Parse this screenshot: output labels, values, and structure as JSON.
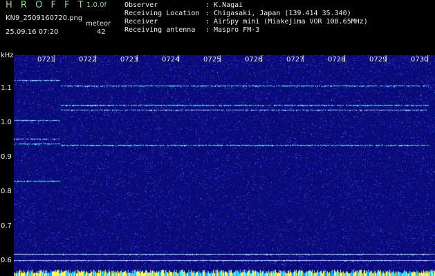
{
  "header": {
    "app_title": "H R O F F T",
    "version": "1.0.0f",
    "filename": "KN9_2509160720.png",
    "mode": "meteor",
    "datetime": "25.09.16 07:20",
    "count": "42"
  },
  "info": [
    {
      "label": "Observer",
      "value": ": K.Nagai"
    },
    {
      "label": "Receiving Location",
      "value": ": Chigasaki, Japan (139.414 35.340)"
    },
    {
      "label": "Receiver",
      "value": ": AirSpy mini (Miakejima VOR 108.65MHz)"
    },
    {
      "label": "Receiving antenna",
      "value": ": Maspro FM-3"
    }
  ],
  "colors": {
    "background": "#0a0a78",
    "noise_speck": "#3a4dff",
    "signal_line": "#7fe0ff",
    "header_green": "#7fe07f",
    "bottom_band": "#ffff40"
  },
  "chart_data": {
    "type": "heatmap",
    "ylabel": "kHz",
    "y_ticks": [
      "1.1",
      "1.0",
      "0.9",
      "0.8",
      "0.7",
      "0.6"
    ],
    "y_tick_values": [
      1.1,
      1.0,
      0.9,
      0.8,
      0.7,
      0.6
    ],
    "ylim": [
      0.575,
      1.15
    ],
    "x_ticks": [
      "0721",
      "0722",
      "0723",
      "0724",
      "0725",
      "0726",
      "0727",
      "0728",
      "0729",
      "0730"
    ],
    "xlim": [
      0,
      10
    ],
    "change_at": 1.12,
    "traces": [
      {
        "freq": 1.125,
        "x_start": 0.0,
        "x_end": 1.12
      },
      {
        "freq": 1.008,
        "x_start": 0.0,
        "x_end": 1.12
      },
      {
        "freq": 0.955,
        "x_start": 0.0,
        "x_end": 1.12
      },
      {
        "freq": 0.94,
        "x_start": 0.0,
        "x_end": 1.12
      },
      {
        "freq": 0.833,
        "x_start": 0.0,
        "x_end": 1.12
      },
      {
        "freq": 1.108,
        "x_start": 1.12,
        "x_end": 10.0
      },
      {
        "freq": 1.053,
        "x_start": 1.12,
        "x_end": 10.0
      },
      {
        "freq": 1.038,
        "x_start": 1.12,
        "x_end": 10.0
      },
      {
        "freq": 0.937,
        "x_start": 1.12,
        "x_end": 10.0
      },
      {
        "freq": 0.62,
        "x_start": 0.0,
        "x_end": 10.0
      },
      {
        "freq": 0.603,
        "x_start": 0.0,
        "x_end": 10.0
      }
    ]
  }
}
